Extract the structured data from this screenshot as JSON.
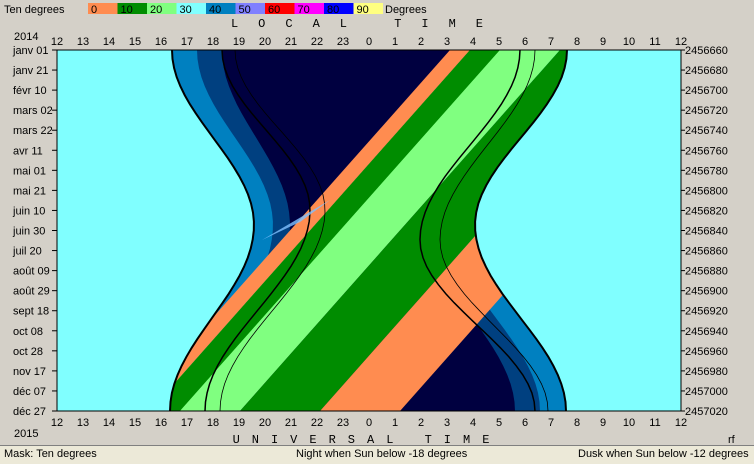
{
  "chart_data": {
    "type": "heatmap",
    "title_top": "LOCAL TIME",
    "title_bottom": "UNIVERSAL TIME",
    "year_top": "2014",
    "year_bottom": "2015",
    "legend": {
      "title": "Ten degrees",
      "unit": "Degrees",
      "items": [
        {
          "label": "0",
          "color": "#ff8c50"
        },
        {
          "label": "10",
          "color": "#008c00"
        },
        {
          "label": "20",
          "color": "#80ff80"
        },
        {
          "label": "30",
          "color": "#80ffff"
        },
        {
          "label": "40",
          "color": "#0080c0"
        },
        {
          "label": "50",
          "color": "#8080ff"
        },
        {
          "label": "60",
          "color": "#ff0000"
        },
        {
          "label": "70",
          "color": "#ff00ff"
        },
        {
          "label": "80",
          "color": "#0000ff"
        },
        {
          "label": "90",
          "color": "#ffff80"
        }
      ]
    },
    "x_ticks": [
      "12",
      "13",
      "14",
      "15",
      "16",
      "17",
      "18",
      "19",
      "20",
      "21",
      "22",
      "23",
      "0",
      "1",
      "2",
      "3",
      "4",
      "5",
      "6",
      "7",
      "8",
      "9",
      "10",
      "11",
      "12"
    ],
    "date_labels": [
      "janv 01",
      "janv 21",
      "févr 10",
      "mars 02",
      "mars 22",
      "avr 11",
      "mai 01",
      "mai 21",
      "juin 10",
      "juin 30",
      "juil 20",
      "août 09",
      "août 29",
      "sept 18",
      "oct 08",
      "oct 28",
      "nov 17",
      "déc 07",
      "déc 27"
    ],
    "jd_labels": [
      "2456660",
      "2456680",
      "2456700",
      "2456720",
      "2456740",
      "2456760",
      "2456780",
      "2456800",
      "2456820",
      "2456840",
      "2456860",
      "2456880",
      "2456900",
      "2456920",
      "2456940",
      "2456960",
      "2456980",
      "2457000",
      "2457020"
    ],
    "corner_label": "rf",
    "colors": {
      "sky": "#80ffff",
      "dusk": "#0080c0",
      "deep_dusk": "#004080",
      "night": "#000040",
      "band_orange": "#ff8c50",
      "band_dark_green": "#008c00",
      "band_light_green": "#80ff80"
    }
  },
  "status": {
    "mask": "Mask:  Ten degrees",
    "night": "Night when Sun below -18 degrees",
    "dusk": "Dusk when Sun below -12 degrees"
  }
}
